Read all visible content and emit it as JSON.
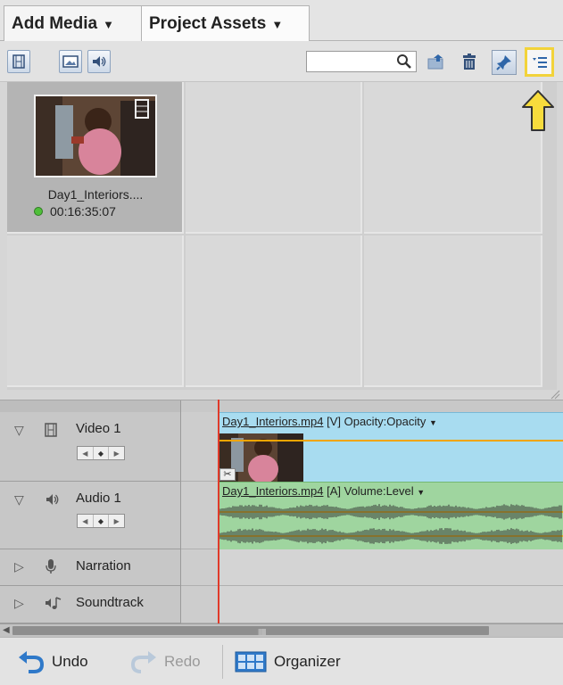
{
  "tabs": {
    "add_media": "Add Media",
    "project_assets": "Project Assets"
  },
  "toolbar": {
    "search_value": "",
    "search_placeholder": ""
  },
  "media": {
    "clip_name": "Day1_Interiors....",
    "clip_duration": "00:16:35:07"
  },
  "timeline": {
    "tracks": {
      "video": "Video 1",
      "audio": "Audio 1",
      "narration": "Narration",
      "soundtrack": "Soundtrack"
    },
    "video_clip": {
      "file": "Day1_Interiors.mp4",
      "tag": "[V]",
      "property": "Opacity:Opacity"
    },
    "audio_clip": {
      "file": "Day1_Interiors.mp4",
      "tag": "[A]",
      "property": "Volume:Level"
    }
  },
  "bottom": {
    "undo": "Undo",
    "redo": "Redo",
    "organizer": "Organizer"
  },
  "colors": {
    "highlight": "#f2d33a",
    "video_track": "#a8dcf0",
    "audio_track": "#9fd59f",
    "playhead": "#e03a2a",
    "undo_icon": "#2f79c9"
  }
}
